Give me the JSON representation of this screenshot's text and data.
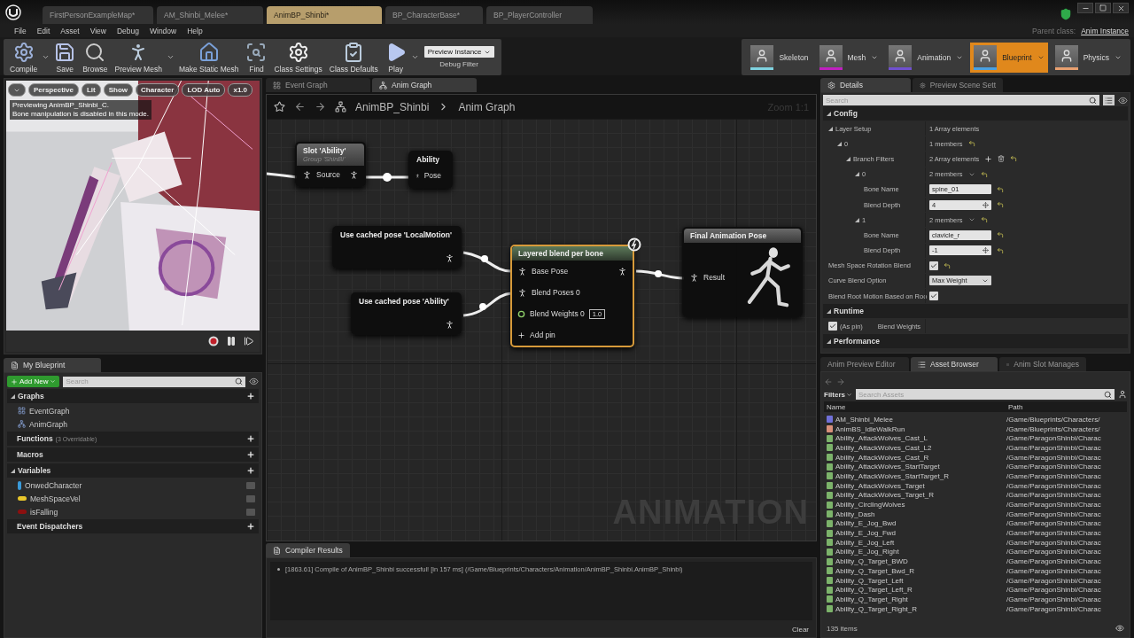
{
  "document_tabs": [
    {
      "label": "FirstPersonExampleMap*",
      "selected": false
    },
    {
      "label": "AM_Shinbi_Melee*",
      "selected": false
    },
    {
      "label": "AnimBP_Shinbi*",
      "selected": true
    },
    {
      "label": "BP_CharacterBase*",
      "selected": false
    },
    {
      "label": "BP_PlayerController",
      "selected": false
    }
  ],
  "menu": [
    "File",
    "Edit",
    "Asset",
    "View",
    "Debug",
    "Window",
    "Help"
  ],
  "parent_class": {
    "label": "Parent class:",
    "value": "Anim Instance"
  },
  "toolbar": [
    {
      "label": "Compile",
      "dropdown": true
    },
    {
      "label": "Save",
      "dropdown": false
    },
    {
      "label": "Browse",
      "dropdown": false
    },
    {
      "label": "Preview Mesh",
      "dropdown": true
    },
    {
      "label": "Make Static Mesh",
      "dropdown": false
    },
    {
      "label": "Find",
      "dropdown": false
    },
    {
      "label": "Class Settings",
      "dropdown": false
    },
    {
      "label": "Class Defaults",
      "dropdown": false
    },
    {
      "label": "Play",
      "dropdown": true
    }
  ],
  "debug_filter": {
    "value": "Preview Instance",
    "label": "Debug Filter"
  },
  "modes": [
    {
      "label": "Skeleton",
      "color": "#7fd3e0",
      "selected": false,
      "dropdown": false
    },
    {
      "label": "Mesh",
      "color": "#c020c0",
      "selected": false,
      "dropdown": true
    },
    {
      "label": "Animation",
      "color": "#7050d0",
      "selected": false,
      "dropdown": true
    },
    {
      "label": "Blueprint",
      "color": "#4aa0e0",
      "selected": true,
      "dropdown": true
    },
    {
      "label": "Physics",
      "color": "#e8a070",
      "selected": false,
      "dropdown": true
    }
  ],
  "viewport": {
    "toolbar": [
      "Perspective",
      "Lit",
      "Show",
      "Character",
      "LOD Auto",
      "x1.0"
    ],
    "notice": [
      "Previewing AnimBP_Shinbi_C.",
      "Bone manipulation is disabled in this mode."
    ]
  },
  "my_blueprint": {
    "tab": "My Blueprint",
    "add_new": "Add New",
    "search": {
      "placeholder": "Search"
    },
    "sections": [
      {
        "title": "Graphs",
        "expanded": true,
        "items": [
          {
            "label": "EventGraph"
          },
          {
            "label": "AnimGraph"
          }
        ]
      },
      {
        "title": "Functions",
        "note": "(3 Overridable)",
        "expanded": false
      },
      {
        "title": "Macros",
        "expanded": false
      },
      {
        "title": "Variables",
        "expanded": true,
        "items": [
          {
            "label": "OnwedCharacter",
            "color": "#3a9ad9"
          },
          {
            "label": "MeshSpaceVel",
            "color": "#e8c62b"
          },
          {
            "label": "isFalling",
            "color": "#8c1010"
          }
        ]
      },
      {
        "title": "Event Dispatchers",
        "expanded": false
      }
    ]
  },
  "graph": {
    "tabs": [
      {
        "label": "Event Graph",
        "selected": false
      },
      {
        "label": "Anim Graph",
        "selected": true
      }
    ],
    "breadcrumb": [
      "AnimBP_Shinbi",
      "Anim Graph"
    ],
    "zoom": "Zoom 1:1",
    "watermark": "ANIMATION",
    "nodes": [
      {
        "kind": "slot",
        "title": "Slot 'Ability'",
        "subtitle": "Group 'ShinBi'",
        "selected": false,
        "pins": [
          {
            "kind": "pose",
            "label": "Source",
            "input": true,
            "output": true
          }
        ]
      },
      {
        "kind": "output",
        "title": "Ability",
        "selected": false,
        "pins": [
          {
            "kind": "pose",
            "label": "Pose",
            "input": true,
            "output": false
          }
        ]
      },
      {
        "kind": "cached",
        "title": "Use cached pose 'LocalMotion'",
        "selected": false,
        "pins": [
          {
            "kind": "pose",
            "input": false,
            "output": true
          }
        ]
      },
      {
        "kind": "cached",
        "title": "Use cached pose 'Ability'",
        "selected": false,
        "pins": [
          {
            "kind": "pose",
            "input": false,
            "output": true
          }
        ]
      },
      {
        "kind": "blend",
        "title": "Layered blend per bone",
        "selected": true,
        "pins": [
          {
            "kind": "pose",
            "label": "Base Pose",
            "input": true,
            "output": true
          },
          {
            "kind": "pose",
            "label": "Blend Poses 0",
            "input": true,
            "output": false
          },
          {
            "kind": "float",
            "label": "Blend Weights 0",
            "value": "1.0",
            "input": true,
            "output": false
          },
          {
            "kind": "add",
            "label": "Add pin",
            "input": false,
            "output": false
          }
        ]
      },
      {
        "kind": "final",
        "title": "Final Animation Pose",
        "selected": false,
        "pins": [
          {
            "kind": "pose",
            "label": "Result",
            "input": true,
            "output": false
          }
        ]
      }
    ]
  },
  "compiler": {
    "tab": "Compiler Results",
    "messages": [
      "[1863.61] Compile of AnimBP_Shinbi successful! [in 157 ms] (/Game/Blueprints/Characters/Animation/AnimBP_Shinbi.AnimBP_Shinbi)"
    ],
    "clear": "Clear"
  },
  "details": {
    "tabs": [
      {
        "label": "Details",
        "selected": true
      },
      {
        "label": "Preview Scene Sett",
        "selected": false
      }
    ],
    "search": {
      "placeholder": "Search"
    },
    "sections": [
      {
        "title": "Config",
        "expanded": true,
        "rows": [
          {
            "kind": "info",
            "label": "Layer Setup",
            "value": "1 Array elements",
            "expanded": true,
            "modified": false,
            "children": [
              {
                "kind": "info",
                "label": "0",
                "value": "1 members",
                "expanded": true,
                "modified": true,
                "children": [
                  {
                    "kind": "array",
                    "label": "Branch Filters",
                    "value": "2 Array elements",
                    "expanded": true,
                    "modified": true,
                    "children": [
                      {
                        "kind": "struct",
                        "label": "0",
                        "value": "2 members",
                        "expanded": true,
                        "modified": true,
                        "children": [
                          {
                            "kind": "text",
                            "label": "Bone Name",
                            "value": "spine_01",
                            "modified": true
                          },
                          {
                            "kind": "number",
                            "label": "Blend Depth",
                            "value": "4",
                            "modified": true
                          }
                        ]
                      },
                      {
                        "kind": "struct",
                        "label": "1",
                        "value": "2 members",
                        "expanded": true,
                        "modified": true,
                        "children": [
                          {
                            "kind": "text",
                            "label": "Bone Name",
                            "value": "clavicle_r",
                            "modified": true
                          },
                          {
                            "kind": "number",
                            "label": "Blend Depth",
                            "value": "-1",
                            "modified": true
                          }
                        ]
                      }
                    ]
                  }
                ]
              }
            ]
          },
          {
            "kind": "checkbox",
            "label": "Mesh Space Rotation Blend",
            "checked": true,
            "modified": true
          },
          {
            "kind": "select",
            "label": "Curve Blend Option",
            "value": "Max Weight",
            "modified": false
          },
          {
            "kind": "checkbox",
            "label": "Blend Root Motion Based on Roo",
            "checked": true,
            "modified": false
          }
        ]
      },
      {
        "title": "Runtime",
        "expanded": true,
        "rows": [
          {
            "kind": "pin",
            "label": "Blend Weights",
            "pin_label": "(As pin)",
            "checked": true,
            "modified": false
          }
        ]
      },
      {
        "title": "Performance",
        "expanded": true
      }
    ]
  },
  "assets": {
    "tabs": [
      {
        "label": "Anim Preview Editor",
        "selected": false
      },
      {
        "label": "Asset Browser",
        "selected": true
      },
      {
        "label": "Anim Slot Manages",
        "selected": false
      }
    ],
    "filters": "Filters",
    "search": {
      "placeholder": "Search Assets"
    },
    "columns": [
      "Name",
      "Path"
    ],
    "footer": "135 items",
    "rows": [
      {
        "name": "AM_Shinbi_Melee",
        "path": "/Game/Blueprints/Characters/",
        "color": "#7070d8"
      },
      {
        "name": "AnimBS_IdleWalkRun",
        "path": "/Game/Blueprints/Characters/",
        "color": "#d8907a"
      },
      {
        "name": "Ability_AttackWolves_Cast_L",
        "path": "/Game/ParagonShinbi/Charac",
        "color": "#7cb36a"
      },
      {
        "name": "Ability_AttackWolves_Cast_L2",
        "path": "/Game/ParagonShinbi/Charac",
        "color": "#7cb36a"
      },
      {
        "name": "Ability_AttackWolves_Cast_R",
        "path": "/Game/ParagonShinbi/Charac",
        "color": "#7cb36a"
      },
      {
        "name": "Ability_AttackWolves_StartTarget",
        "path": "/Game/ParagonShinbi/Charac",
        "color": "#7cb36a"
      },
      {
        "name": "Ability_AttackWolves_StartTarget_R",
        "path": "/Game/ParagonShinbi/Charac",
        "color": "#7cb36a"
      },
      {
        "name": "Ability_AttackWolves_Target",
        "path": "/Game/ParagonShinbi/Charac",
        "color": "#7cb36a"
      },
      {
        "name": "Ability_AttackWolves_Target_R",
        "path": "/Game/ParagonShinbi/Charac",
        "color": "#7cb36a"
      },
      {
        "name": "Ability_CirclingWolves",
        "path": "/Game/ParagonShinbi/Charac",
        "color": "#7cb36a"
      },
      {
        "name": "Ability_Dash",
        "path": "/Game/ParagonShinbi/Charac",
        "color": "#7cb36a"
      },
      {
        "name": "Ability_E_Jog_Bwd",
        "path": "/Game/ParagonShinbi/Charac",
        "color": "#7cb36a"
      },
      {
        "name": "Ability_E_Jog_Fwd",
        "path": "/Game/ParagonShinbi/Charac",
        "color": "#7cb36a"
      },
      {
        "name": "Ability_E_Jog_Left",
        "path": "/Game/ParagonShinbi/Charac",
        "color": "#7cb36a"
      },
      {
        "name": "Ability_E_Jog_Right",
        "path": "/Game/ParagonShinbi/Charac",
        "color": "#7cb36a"
      },
      {
        "name": "Ability_Q_Target_BWD",
        "path": "/Game/ParagonShinbi/Charac",
        "color": "#7cb36a"
      },
      {
        "name": "Ability_Q_Target_Bwd_R",
        "path": "/Game/ParagonShinbi/Charac",
        "color": "#7cb36a"
      },
      {
        "name": "Ability_Q_Target_Left",
        "path": "/Game/ParagonShinbi/Charac",
        "color": "#7cb36a"
      },
      {
        "name": "Ability_Q_Target_Left_R",
        "path": "/Game/ParagonShinbi/Charac",
        "color": "#7cb36a"
      },
      {
        "name": "Ability_Q_Target_Right",
        "path": "/Game/ParagonShinbi/Charac",
        "color": "#7cb36a"
      },
      {
        "name": "Ability_Q_Target_Right_R",
        "path": "/Game/ParagonShinbi/Charac",
        "color": "#7cb36a"
      }
    ]
  }
}
